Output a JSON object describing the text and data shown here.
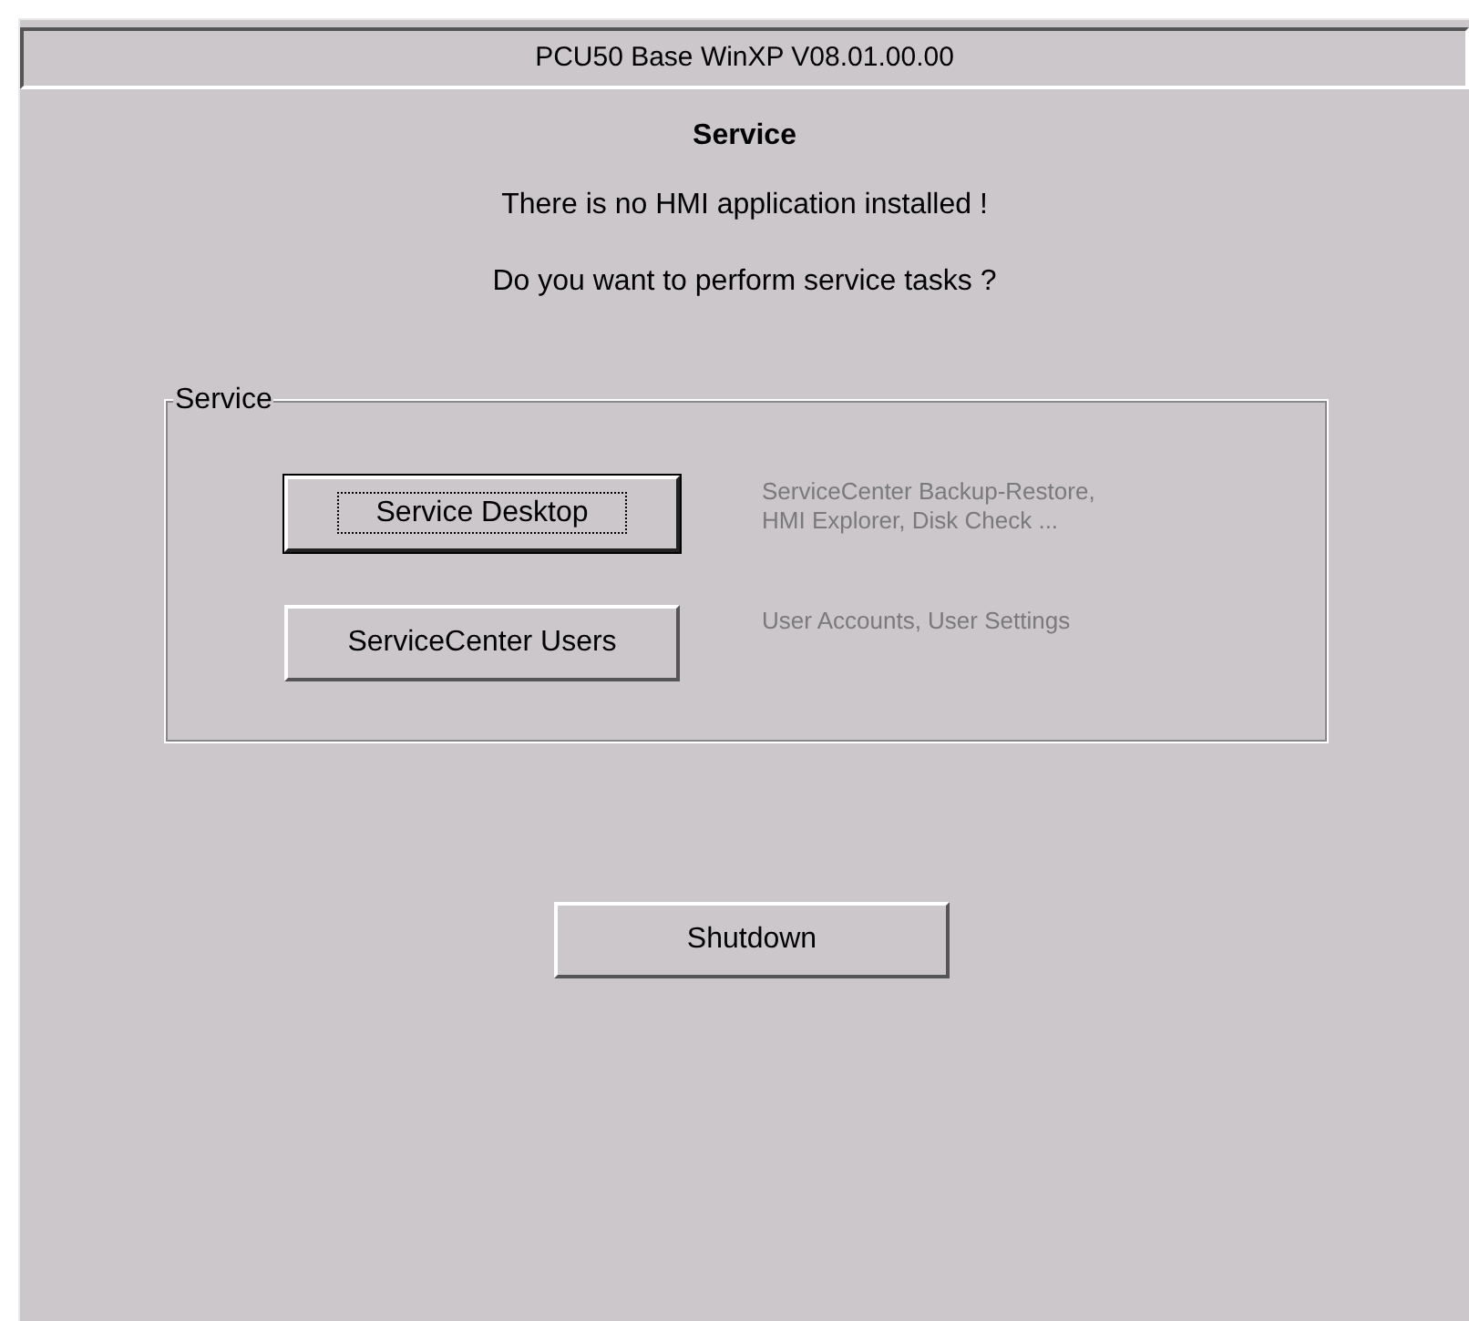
{
  "window": {
    "title": "PCU50 Base WinXP V08.01.00.00"
  },
  "heading": "Service",
  "messages": [
    "There is no HMI application installed !",
    "Do you want to perform service tasks ?"
  ],
  "group": {
    "title": "Service",
    "buttons": [
      {
        "label": "Service Desktop",
        "focused": true,
        "description": [
          "ServiceCenter Backup-Restore,",
          "HMI Explorer, Disk Check ..."
        ]
      },
      {
        "label": "ServiceCenter Users",
        "focused": false,
        "description": [
          "User Accounts, User Settings"
        ]
      }
    ]
  },
  "shutdown": {
    "label": "Shutdown"
  }
}
